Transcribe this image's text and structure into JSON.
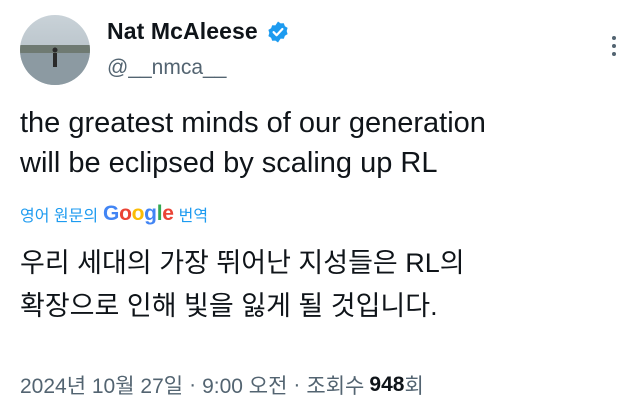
{
  "author": {
    "name": "Nat McAleese",
    "handle": "@__nmca__",
    "verified_color": "#1d9bf0"
  },
  "tweet": {
    "line1": "the greatest minds of our generation",
    "line2": "will be eclipsed by scaling up RL"
  },
  "translation": {
    "prefix": "영어 원문의",
    "brand": "Google",
    "suffix": "번역",
    "line1": "우리 세대의 가장 뛰어난 지성들은 RL의",
    "line2": "확장으로 인해 빛을 잃게 될 것입니다."
  },
  "meta": {
    "date": "2024년 10월 27일",
    "separator": "·",
    "time": "9:00 오전",
    "views_label": "조회수",
    "views_count": "948",
    "views_suffix": "회"
  },
  "colors": {
    "link": "#1d9bf0",
    "secondary": "#536471",
    "primary_text": "#0f1419"
  },
  "icons": [
    "verified-badge-icon",
    "more-options-icon",
    "google-logo"
  ]
}
